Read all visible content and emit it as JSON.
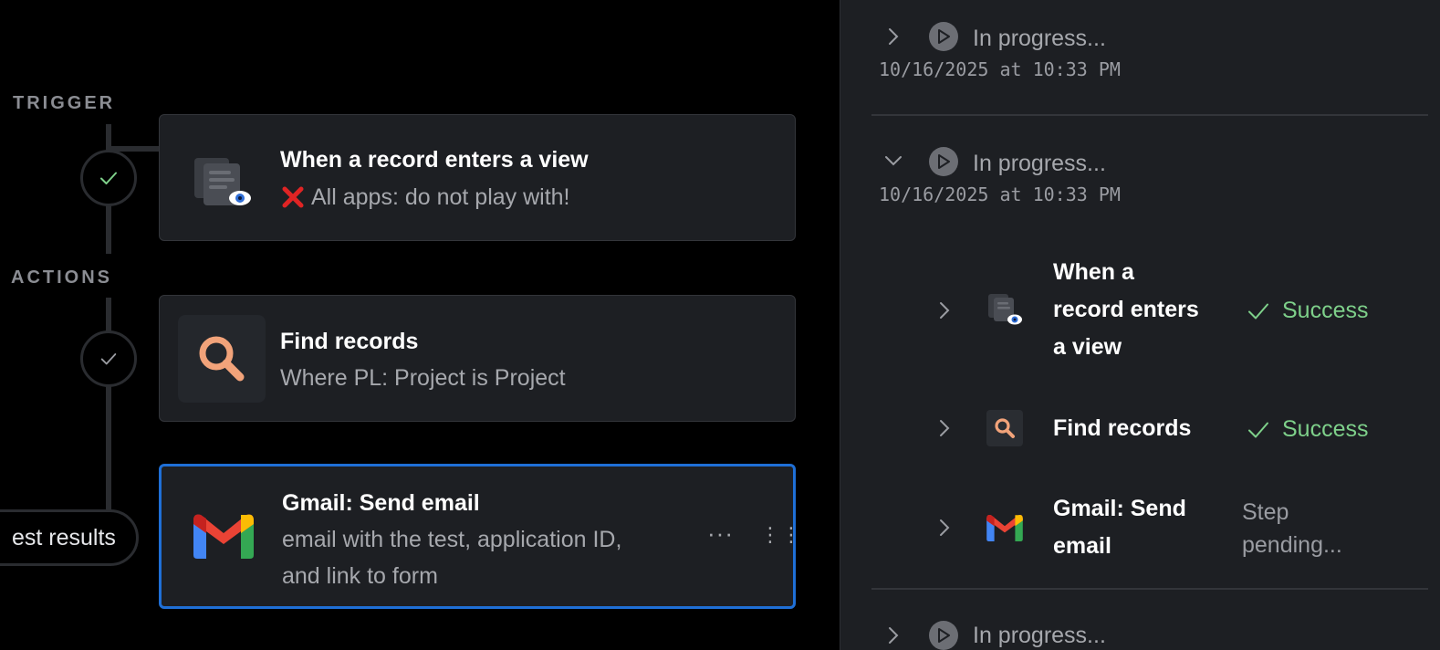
{
  "workflow": {
    "trigger_label": "TRIGGER",
    "actions_label": "ACTIONS",
    "branch_pill": "est results",
    "trigger_card": {
      "icon": "record-view-icon",
      "title": "When a record enters a view",
      "subtitle_icon": "red-x-icon",
      "subtitle": "All apps: do not play with!"
    },
    "find_card": {
      "icon": "search-icon",
      "title": "Find records",
      "subtitle": "Where PL: Project is Project"
    },
    "gmail_card": {
      "icon": "gmail-icon",
      "title": "Gmail: Send email",
      "subtitle_line1": "email with the test, application ID,",
      "subtitle_line2": "and link to form",
      "menu_glyph": "···",
      "drag_glyph": "⋮⋮"
    }
  },
  "runs": [
    {
      "status": "In progress...",
      "timestamp": "10/16/2025 at 10:33 PM",
      "expanded": false
    },
    {
      "status": "In progress...",
      "timestamp": "10/16/2025 at 10:33 PM",
      "expanded": true,
      "steps": [
        {
          "title_lines": [
            "When a",
            "record enters",
            "a view"
          ],
          "icon": "record-view-icon",
          "status": "Success"
        },
        {
          "title_lines": [
            "Find records"
          ],
          "icon": "search-icon",
          "status": "Success"
        },
        {
          "title_lines": [
            "Gmail: Send",
            "email"
          ],
          "icon": "gmail-icon",
          "status_lines": [
            "Step",
            "pending..."
          ]
        }
      ]
    },
    {
      "status": "In progress...",
      "expanded": false
    }
  ],
  "colors": {
    "success": "#7ed08a",
    "selected_border": "#1f6fd6",
    "search_accent": "#f2a37a",
    "error": "#e02424"
  }
}
